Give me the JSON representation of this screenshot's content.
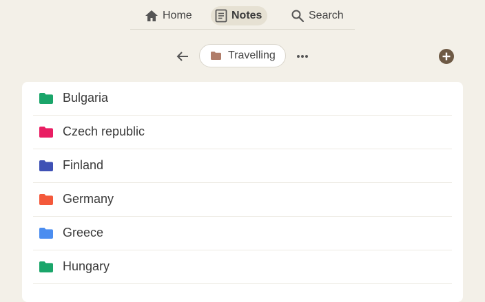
{
  "nav": {
    "items": [
      {
        "label": "Home",
        "icon": "home-icon"
      },
      {
        "label": "Notes",
        "icon": "notes-icon",
        "active": true
      },
      {
        "label": "Search",
        "icon": "search-icon"
      }
    ]
  },
  "breadcrumb": {
    "label": "Travelling",
    "folder_color": "#b07d6a",
    "back_icon": "arrow-left-icon",
    "more_icon": "more-horizontal-icon"
  },
  "add_button": {
    "icon": "add-circle-icon",
    "color": "#6e5a45"
  },
  "folders": [
    {
      "name": "Bulgaria",
      "color": "#1aa56a"
    },
    {
      "name": "Czech republic",
      "color": "#e91e63"
    },
    {
      "name": "Finland",
      "color": "#3f51b5"
    },
    {
      "name": "Germany",
      "color": "#f4593b"
    },
    {
      "name": "Greece",
      "color": "#4b8df0"
    },
    {
      "name": "Hungary",
      "color": "#1aa56a"
    }
  ]
}
